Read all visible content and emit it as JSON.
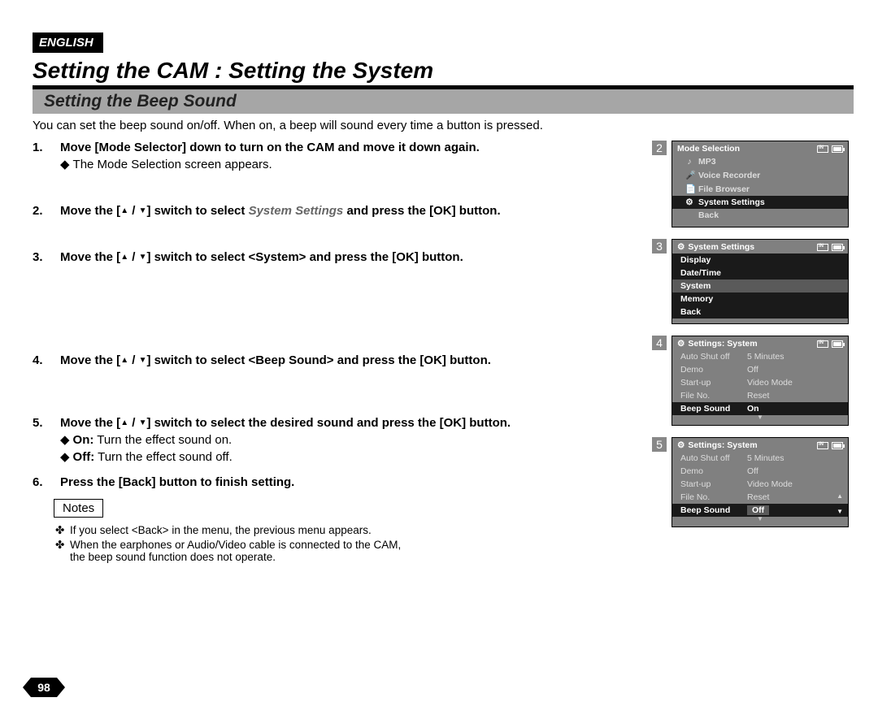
{
  "lang_tag": "ENGLISH",
  "title": "Setting the CAM : Setting the System",
  "section": "Setting the Beep Sound",
  "intro": "You can set the beep sound on/off. When on, a beep will sound every time a button is pressed.",
  "steps": {
    "s1": {
      "num": "1.",
      "text": "Move [Mode Selector] down to turn on the CAM and move it down again.",
      "sub1": "The Mode Selection screen appears."
    },
    "s2": {
      "num": "2.",
      "pre": "Move the [",
      "mid": "] switch to select ",
      "target": "System Settings",
      "post": " and press the [OK] button."
    },
    "s3": {
      "num": "3.",
      "pre": "Move the [",
      "mid": "] switch to select <System> and press the [OK] button."
    },
    "s4": {
      "num": "4.",
      "pre": "Move the [",
      "mid": "] switch to select <Beep Sound> and press the [OK] button."
    },
    "s5": {
      "num": "5.",
      "pre": "Move the [",
      "mid": "] switch to select the desired sound and press the [OK] button.",
      "opt_on_label": "On:",
      "opt_on": " Turn the effect sound on.",
      "opt_off_label": "Off:",
      "opt_off": " Turn the effect sound off."
    },
    "s6": {
      "num": "6.",
      "text": "Press the [Back] button to finish setting."
    }
  },
  "notes": {
    "label": "Notes",
    "n1": "If you select <Back> in the menu, the previous menu appears.",
    "n2a": "When the earphones or Audio/Video cable is connected to the CAM,",
    "n2b": "the beep sound function does not operate."
  },
  "page_number": "98",
  "shots": {
    "s2": {
      "num": "2",
      "title": "Mode Selection",
      "items": [
        {
          "icon": "♪",
          "label": "MP3"
        },
        {
          "icon": "🎤",
          "label": "Voice Recorder"
        },
        {
          "icon": "📄",
          "label": "File Browser"
        },
        {
          "icon": "⚙",
          "label": "System Settings",
          "sel": true
        },
        {
          "icon": "",
          "label": "Back"
        }
      ]
    },
    "s3": {
      "num": "3",
      "title": "System Settings",
      "rows": [
        "Display",
        "Date/Time",
        "System",
        "Memory",
        "Back"
      ],
      "sel": "System"
    },
    "s4": {
      "num": "4",
      "title": "Settings: System",
      "rows": [
        {
          "k": "Auto Shut off",
          "v": "5 Minutes"
        },
        {
          "k": "Demo",
          "v": "Off"
        },
        {
          "k": "Start-up",
          "v": "Video Mode"
        },
        {
          "k": "File No.",
          "v": "Reset"
        },
        {
          "k": "Beep Sound",
          "v": "On",
          "sel": true
        }
      ]
    },
    "s5": {
      "num": "5",
      "title": "Settings: System",
      "rows": [
        {
          "k": "Auto Shut off",
          "v": "5 Minutes"
        },
        {
          "k": "Demo",
          "v": "Off"
        },
        {
          "k": "Start-up",
          "v": "Video Mode"
        },
        {
          "k": "File No.",
          "v": "Reset"
        },
        {
          "k": "Beep Sound",
          "v": "Off",
          "sel": true,
          "optsel": true
        }
      ]
    }
  }
}
